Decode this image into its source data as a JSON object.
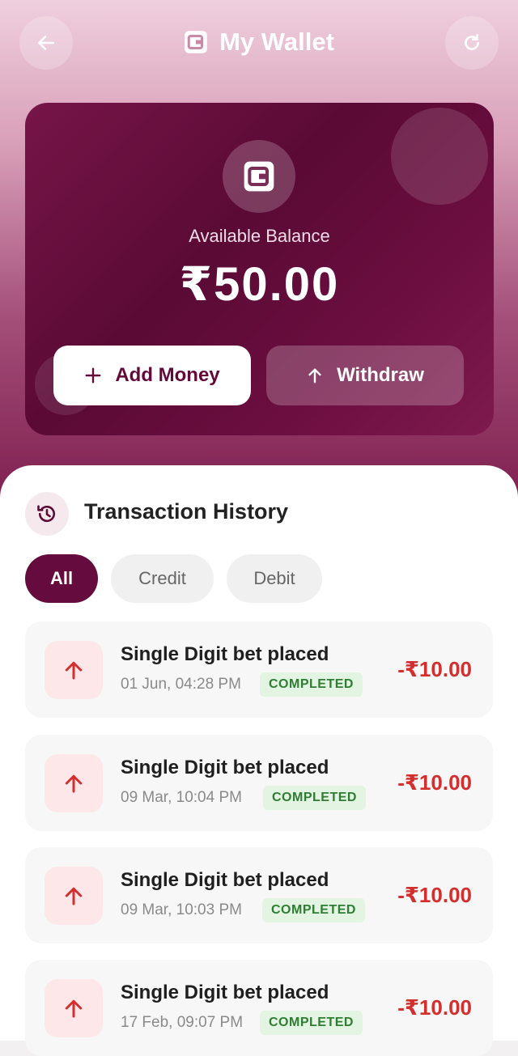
{
  "header": {
    "title": "My Wallet",
    "back_icon": "arrow-left-icon",
    "refresh_icon": "refresh-icon",
    "wallet_icon": "wallet-icon"
  },
  "balance_card": {
    "label": "Available Balance",
    "amount": "₹50.00",
    "add_money_label": "Add Money",
    "withdraw_label": "Withdraw"
  },
  "history": {
    "title": "Transaction History",
    "filters": [
      "All",
      "Credit",
      "Debit"
    ],
    "active_filter": "All",
    "transactions": [
      {
        "title": "Single Digit bet placed",
        "date": "01 Jun, 04:28 PM",
        "status": "COMPLETED",
        "amount": "-₹10.00"
      },
      {
        "title": "Single Digit bet placed",
        "date": "09 Mar, 10:04 PM",
        "status": "COMPLETED",
        "amount": "-₹10.00"
      },
      {
        "title": "Single Digit bet placed",
        "date": "09 Mar, 10:03 PM",
        "status": "COMPLETED",
        "amount": "-₹10.00"
      },
      {
        "title": "Single Digit bet placed",
        "date": "17 Feb, 09:07 PM",
        "status": "COMPLETED",
        "amount": "-₹10.00"
      }
    ]
  },
  "colors": {
    "brand": "#650b3d",
    "debit": "#d32f2f",
    "status_completed": "#2e7d32"
  }
}
